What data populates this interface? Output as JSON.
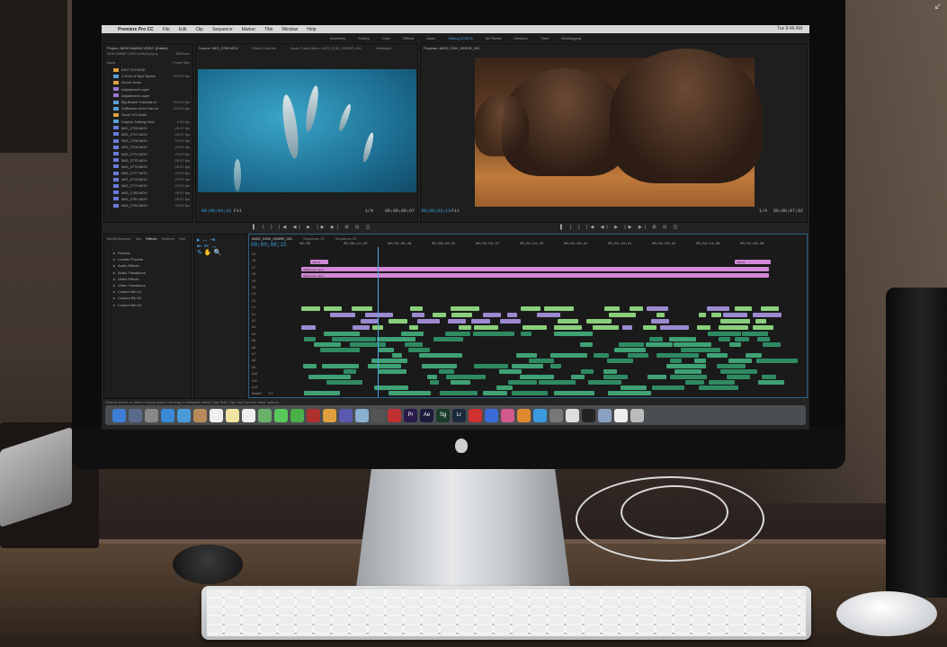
{
  "app": {
    "name": "Premiere Pro CC",
    "menus": [
      "File",
      "Edit",
      "Clip",
      "Sequence",
      "Marker",
      "Title",
      "Window",
      "Help"
    ],
    "clock": "Tue 8:46 AM"
  },
  "workspaces": [
    "Assembly",
    "Editing",
    "Color",
    "Effects",
    "Audio",
    "Editing (CS5.5)",
    "All Panels",
    "Libraries",
    "Titles",
    "Metalogging"
  ],
  "project": {
    "title": "Project: NEW HAWAII VIDEO (Edited)",
    "file": "NEW HAWAII VIDEO (Edited).prproj",
    "count": "683 Items",
    "cols": [
      "Name",
      "Frame Rate"
    ],
    "items": [
      {
        "name": "EDIT DOTAGE",
        "fps": "",
        "color": "#e0a040"
      },
      {
        "name": "1 Hour of Epic Space",
        "fps": "23.976 fps",
        "color": "#56a0d8"
      },
      {
        "name": "Drone Grain",
        "fps": "",
        "color": "#e0a040"
      },
      {
        "name": "Adjustment Layer",
        "fps": "",
        "color": "#9c7ad0"
      },
      {
        "name": "Adjustment Layer",
        "fps": "",
        "color": "#9c7ad0"
      },
      {
        "name": "Big Beach Tutorials.m",
        "fps": "23.976 fps",
        "color": "#56a0d8"
      },
      {
        "name": "Sufflowers End Card.m",
        "fps": "23.976 fps",
        "color": "#56a0d8"
      },
      {
        "name": "Scrub VO Audio",
        "fps": "",
        "color": "#e0a040"
      },
      {
        "name": "Dolphin Talking Undr",
        "fps": "0.00 fps",
        "color": "#56a0d8"
      },
      {
        "name": "IMG_2705.MOV",
        "fps": "29.97 fps",
        "color": "#6a7ad8"
      },
      {
        "name": "IMG_2707.MOV",
        "fps": "29.97 fps",
        "color": "#6a7ad8"
      },
      {
        "name": "IMG_2708.MOV",
        "fps": "29.97 fps",
        "color": "#6a7ad8"
      },
      {
        "name": "IMG_2709.MOV",
        "fps": "29.97 fps",
        "color": "#6a7ad8"
      },
      {
        "name": "IMG_2774.MOV",
        "fps": "29.97 fps",
        "color": "#6a7ad8"
      },
      {
        "name": "IMG_2775.MOV",
        "fps": "29.97 fps",
        "color": "#6a7ad8"
      },
      {
        "name": "IMG_2776.MOV",
        "fps": "29.97 fps",
        "color": "#6a7ad8"
      },
      {
        "name": "IMG_2777.MOV",
        "fps": "29.97 fps",
        "color": "#6a7ad8"
      },
      {
        "name": "IMG_2778.MOV",
        "fps": "29.97 fps",
        "color": "#6a7ad8"
      },
      {
        "name": "IMG_2779.MOV",
        "fps": "29.97 fps",
        "color": "#6a7ad8"
      },
      {
        "name": "IMG_2780.MOV",
        "fps": "29.97 fps",
        "color": "#6a7ad8"
      },
      {
        "name": "IMG_2781.MOV",
        "fps": "29.97 fps",
        "color": "#6a7ad8"
      },
      {
        "name": "IMG_2782.MOV",
        "fps": "29.97 fps",
        "color": "#6a7ad8"
      }
    ]
  },
  "source": {
    "title": "Source: IMG_2769.MOV",
    "tabs": [
      "Effect Controls",
      "Audio Track Mixer: A003_C051_003I9R_001",
      "Metadata"
    ],
    "timecode": "00;00;04;16",
    "fit": "Fit",
    "duration": "00;00;00;07",
    "ratio": "1/4"
  },
  "program": {
    "title": "Program: A003_C004_003I9R_001",
    "timecode": "00;00;03;13",
    "fit": "Fit",
    "duration": "00;00;07;02",
    "ratio": "1/4"
  },
  "effects_panel": {
    "tabs": [
      "Media Browser",
      "Info",
      "Effects",
      "Markers",
      "Hist"
    ],
    "items": [
      "Presets",
      "Lumetri Presets",
      "Audio Effects",
      "Audio Transitions",
      "Video Effects",
      "Video Transitions",
      "Custom Bin 01",
      "Custom Bin 02",
      "Custom Bin 03"
    ]
  },
  "timeline": {
    "tabs": [
      "A003_C004_003I9R_001",
      "Sequence 02",
      "Sequence 03"
    ],
    "timecode": "00;00;08;15",
    "ruler": [
      "00;00",
      "00;00;14;23",
      "00;00;29;29",
      "00;00;44;22",
      "00;00;59;27",
      "00;01;14;23",
      "00;01;29;21",
      "00;01;44;21",
      "00;01;59;22",
      "00;02;14;20",
      "00;02;29;20"
    ],
    "tracks": [
      "V9",
      "V8",
      "V7",
      "V6",
      "V5",
      "V4",
      "V3",
      "V2",
      "V1",
      "A1",
      "A2",
      "A3",
      "A4",
      "A5",
      "A6",
      "A7",
      "A8",
      "A9",
      "A10",
      "A11",
      "A12",
      "Master"
    ],
    "master_level": "0.0",
    "clip_labels": {
      "adjust": "Adjustment Layer",
      "title": "Title 01"
    }
  },
  "status": "Click to select, or click in empty space and drag to marquee select. Use Shift, Opt, and Cmd for other options.",
  "dock": {
    "apps": [
      {
        "name": "Finder",
        "color": "#3d7fd6",
        "glyph": ""
      },
      {
        "name": "Launchpad",
        "color": "#5a6a8a",
        "glyph": ""
      },
      {
        "name": "Rocket",
        "color": "#888",
        "glyph": ""
      },
      {
        "name": "Safari",
        "color": "#3a8ad8",
        "glyph": ""
      },
      {
        "name": "Mail",
        "color": "#4a9ad8",
        "glyph": ""
      },
      {
        "name": "Contacts",
        "color": "#b88a5a",
        "glyph": ""
      },
      {
        "name": "Calendar",
        "color": "#eeeeee",
        "glyph": "8"
      },
      {
        "name": "Notes",
        "color": "#f0e4a0",
        "glyph": ""
      },
      {
        "name": "Reminders",
        "color": "#eeeeee",
        "glyph": ""
      },
      {
        "name": "Maps",
        "color": "#6ab06a",
        "glyph": ""
      },
      {
        "name": "Messages",
        "color": "#5ac85a",
        "glyph": ""
      },
      {
        "name": "FaceTime",
        "color": "#4ab04a",
        "glyph": ""
      },
      {
        "name": "Photo Booth",
        "color": "#b03030",
        "glyph": ""
      },
      {
        "name": "Photos",
        "color": "#e0a040",
        "glyph": ""
      },
      {
        "name": "iMovie",
        "color": "#5a5ab0",
        "glyph": ""
      },
      {
        "name": "Preview",
        "color": "#8ab0d0",
        "glyph": ""
      },
      {
        "name": "Camera",
        "color": "#555",
        "glyph": ""
      },
      {
        "name": "DVD",
        "color": "#c03030",
        "glyph": ""
      },
      {
        "name": "Premiere",
        "color": "#2a1a4a",
        "glyph": "Pr"
      },
      {
        "name": "After Effects",
        "color": "#1a1a3a",
        "glyph": "Ae"
      },
      {
        "name": "SpeedGrade",
        "color": "#1a3a2a",
        "glyph": "Sg"
      },
      {
        "name": "Lightroom",
        "color": "#1a2a3a",
        "glyph": "Lr"
      },
      {
        "name": "Creative Cloud",
        "color": "#d03030",
        "glyph": ""
      },
      {
        "name": "Keynote",
        "color": "#3a6ad8",
        "glyph": ""
      },
      {
        "name": "iTunes",
        "color": "#d05a8a",
        "glyph": ""
      },
      {
        "name": "iBooks",
        "color": "#e08a30",
        "glyph": ""
      },
      {
        "name": "App Store",
        "color": "#3a9ae0",
        "glyph": ""
      },
      {
        "name": "System Preferences",
        "color": "#777",
        "glyph": ""
      },
      {
        "name": "TextEdit",
        "color": "#ddd",
        "glyph": ""
      },
      {
        "name": "Terminal",
        "color": "#222",
        "glyph": ""
      },
      {
        "name": "Finder Window",
        "color": "#8aa0c0",
        "glyph": ""
      },
      {
        "name": "Document",
        "color": "#eee",
        "glyph": ""
      },
      {
        "name": "Trash",
        "color": "#bbb",
        "glyph": ""
      }
    ]
  }
}
